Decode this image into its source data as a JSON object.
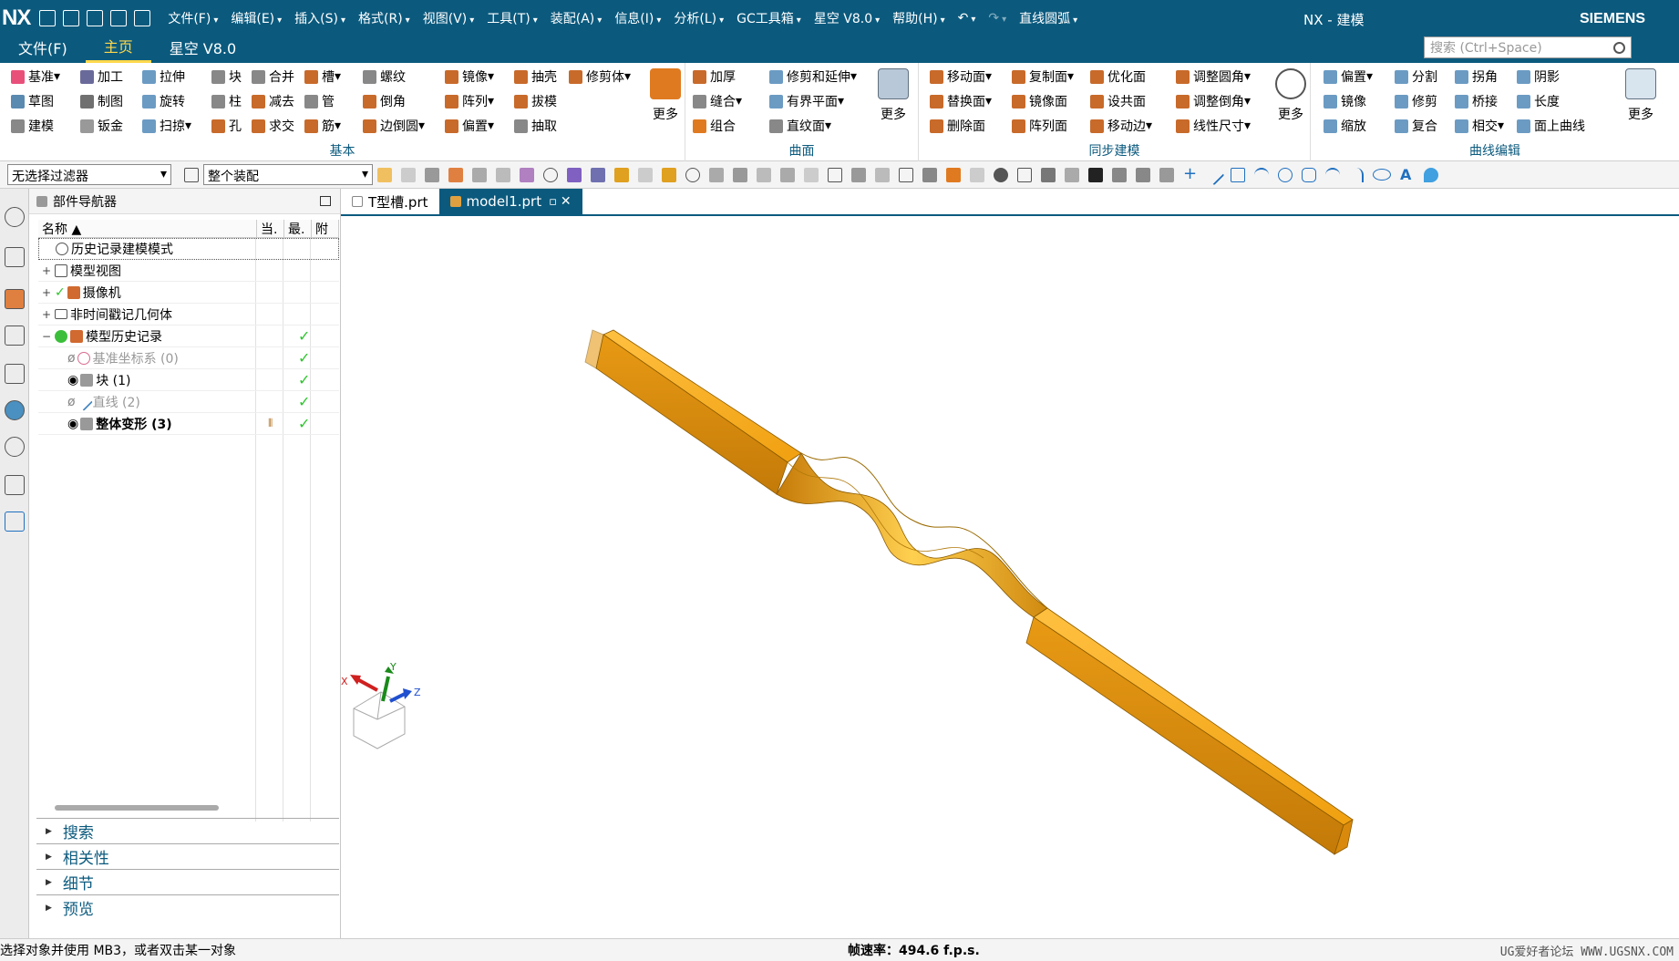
{
  "app": {
    "logo": "NX",
    "window_title": "NX - 建模",
    "brand": "SIEMENS",
    "colors": {
      "titlebar": "#0b5a7e",
      "accent": "#ffd84d",
      "model": "#f0a010",
      "check": "#2ec52e"
    }
  },
  "menu": [
    "文件(F)",
    "编辑(E)",
    "插入(S)",
    "格式(R)",
    "视图(V)",
    "工具(T)",
    "装配(A)",
    "信息(I)",
    "分析(L)",
    "GC工具箱",
    "星空 V8.0",
    "帮助(H)"
  ],
  "quick_label": "直线圆弧",
  "tabs": [
    "文件(F)",
    "主页",
    "星空 V8.0"
  ],
  "search_placeholder": "搜索 (Ctrl+Space)",
  "ribbon": {
    "basic": {
      "label": "基本",
      "col1": [
        "基准",
        "草图",
        "建模"
      ],
      "col2": [
        "加工",
        "制图",
        "钣金"
      ],
      "col3": [
        "拉伸",
        "旋转",
        "扫掠"
      ],
      "col4": [
        "块",
        "柱",
        "孔"
      ],
      "col5": [
        "合并",
        "减去",
        "求交"
      ],
      "col6": [
        "槽",
        "管",
        "筋"
      ],
      "col7": [
        "螺纹",
        "倒角",
        "边倒圆"
      ],
      "col8": [
        "镜像",
        "阵列",
        "偏置"
      ],
      "col9": [
        "抽壳",
        "拔模",
        "抽取"
      ],
      "col10": [
        "修剪体"
      ],
      "more": "更多"
    },
    "surface": {
      "label": "曲面",
      "col1": [
        "加厚",
        "缝合",
        "组合"
      ],
      "col2": [
        "修剪和延伸",
        "有界平面",
        "直纹面"
      ],
      "more": "更多"
    },
    "sync": {
      "label": "同步建模",
      "col1": [
        "移动面",
        "替换面",
        "删除面"
      ],
      "col2": [
        "复制面",
        "镜像面",
        "阵列面"
      ],
      "col3": [
        "优化面",
        "设共面",
        "移动边"
      ],
      "col4": [
        "调整圆角",
        "调整倒角",
        "线性尺寸"
      ],
      "more": "更多"
    },
    "curve": {
      "label": "曲线编辑",
      "col1": [
        "偏置",
        "镜像",
        "缩放"
      ],
      "col2": [
        "分割",
        "修剪",
        "复合"
      ],
      "col3": [
        "拐角",
        "桥接",
        "相交"
      ],
      "col4": [
        "阴影",
        "长度",
        "面上曲线"
      ],
      "more": "更多"
    }
  },
  "filters": {
    "selection_filter": "无选择过滤器",
    "scope": "整个装配"
  },
  "navigator": {
    "title": "部件导航器",
    "columns": [
      "名称",
      "当.",
      "最.",
      "附"
    ],
    "rows": [
      {
        "label": "历史记录建模模式",
        "style": "normal",
        "check": ""
      },
      {
        "label": "模型视图",
        "style": "normal",
        "check": ""
      },
      {
        "label": "摄像机",
        "style": "normal",
        "check": ""
      },
      {
        "label": "非时间戳记几何体",
        "style": "normal",
        "check": ""
      },
      {
        "label": "模型历史记录",
        "style": "normal",
        "check": "✓"
      },
      {
        "label": "基准坐标系 (0)",
        "style": "gray",
        "check": "✓"
      },
      {
        "label": "块 (1)",
        "style": "normal",
        "check": "✓"
      },
      {
        "label": "直线 (2)",
        "style": "gray",
        "check": "✓"
      },
      {
        "label": "整体变形 (3)",
        "style": "bold",
        "check": "✓"
      }
    ]
  },
  "panels": [
    "搜索",
    "相关性",
    "细节",
    "预览"
  ],
  "viewport_tabs": [
    "T型槽.prt",
    "model1.prt"
  ],
  "triad": {
    "x": "X",
    "y": "Y",
    "z": "Z"
  },
  "status": {
    "prompt": "选择对象并使用 MB3，或者双击某一对象",
    "framerate": "帧速率：494.6 f.p.s.",
    "watermark": "UG爱好者论坛 WWW.UGSNX.COM"
  }
}
